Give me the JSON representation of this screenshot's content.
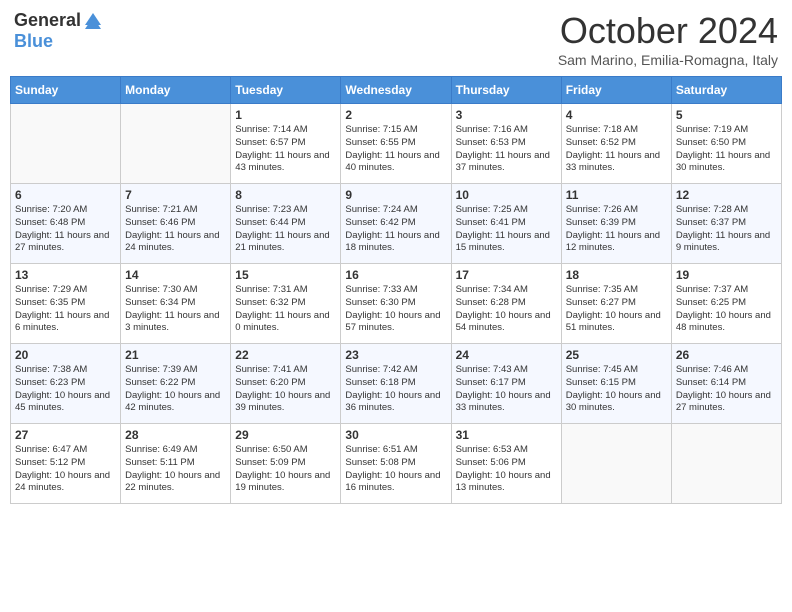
{
  "header": {
    "logo_general": "General",
    "logo_blue": "Blue",
    "month_title": "October 2024",
    "subtitle": "Sam Marino, Emilia-Romagna, Italy"
  },
  "days_of_week": [
    "Sunday",
    "Monday",
    "Tuesday",
    "Wednesday",
    "Thursday",
    "Friday",
    "Saturday"
  ],
  "weeks": [
    [
      {
        "date": "",
        "sunrise": "",
        "sunset": "",
        "daylight": ""
      },
      {
        "date": "",
        "sunrise": "",
        "sunset": "",
        "daylight": ""
      },
      {
        "date": "1",
        "sunrise": "Sunrise: 7:14 AM",
        "sunset": "Sunset: 6:57 PM",
        "daylight": "Daylight: 11 hours and 43 minutes."
      },
      {
        "date": "2",
        "sunrise": "Sunrise: 7:15 AM",
        "sunset": "Sunset: 6:55 PM",
        "daylight": "Daylight: 11 hours and 40 minutes."
      },
      {
        "date": "3",
        "sunrise": "Sunrise: 7:16 AM",
        "sunset": "Sunset: 6:53 PM",
        "daylight": "Daylight: 11 hours and 37 minutes."
      },
      {
        "date": "4",
        "sunrise": "Sunrise: 7:18 AM",
        "sunset": "Sunset: 6:52 PM",
        "daylight": "Daylight: 11 hours and 33 minutes."
      },
      {
        "date": "5",
        "sunrise": "Sunrise: 7:19 AM",
        "sunset": "Sunset: 6:50 PM",
        "daylight": "Daylight: 11 hours and 30 minutes."
      }
    ],
    [
      {
        "date": "6",
        "sunrise": "Sunrise: 7:20 AM",
        "sunset": "Sunset: 6:48 PM",
        "daylight": "Daylight: 11 hours and 27 minutes."
      },
      {
        "date": "7",
        "sunrise": "Sunrise: 7:21 AM",
        "sunset": "Sunset: 6:46 PM",
        "daylight": "Daylight: 11 hours and 24 minutes."
      },
      {
        "date": "8",
        "sunrise": "Sunrise: 7:23 AM",
        "sunset": "Sunset: 6:44 PM",
        "daylight": "Daylight: 11 hours and 21 minutes."
      },
      {
        "date": "9",
        "sunrise": "Sunrise: 7:24 AM",
        "sunset": "Sunset: 6:42 PM",
        "daylight": "Daylight: 11 hours and 18 minutes."
      },
      {
        "date": "10",
        "sunrise": "Sunrise: 7:25 AM",
        "sunset": "Sunset: 6:41 PM",
        "daylight": "Daylight: 11 hours and 15 minutes."
      },
      {
        "date": "11",
        "sunrise": "Sunrise: 7:26 AM",
        "sunset": "Sunset: 6:39 PM",
        "daylight": "Daylight: 11 hours and 12 minutes."
      },
      {
        "date": "12",
        "sunrise": "Sunrise: 7:28 AM",
        "sunset": "Sunset: 6:37 PM",
        "daylight": "Daylight: 11 hours and 9 minutes."
      }
    ],
    [
      {
        "date": "13",
        "sunrise": "Sunrise: 7:29 AM",
        "sunset": "Sunset: 6:35 PM",
        "daylight": "Daylight: 11 hours and 6 minutes."
      },
      {
        "date": "14",
        "sunrise": "Sunrise: 7:30 AM",
        "sunset": "Sunset: 6:34 PM",
        "daylight": "Daylight: 11 hours and 3 minutes."
      },
      {
        "date": "15",
        "sunrise": "Sunrise: 7:31 AM",
        "sunset": "Sunset: 6:32 PM",
        "daylight": "Daylight: 11 hours and 0 minutes."
      },
      {
        "date": "16",
        "sunrise": "Sunrise: 7:33 AM",
        "sunset": "Sunset: 6:30 PM",
        "daylight": "Daylight: 10 hours and 57 minutes."
      },
      {
        "date": "17",
        "sunrise": "Sunrise: 7:34 AM",
        "sunset": "Sunset: 6:28 PM",
        "daylight": "Daylight: 10 hours and 54 minutes."
      },
      {
        "date": "18",
        "sunrise": "Sunrise: 7:35 AM",
        "sunset": "Sunset: 6:27 PM",
        "daylight": "Daylight: 10 hours and 51 minutes."
      },
      {
        "date": "19",
        "sunrise": "Sunrise: 7:37 AM",
        "sunset": "Sunset: 6:25 PM",
        "daylight": "Daylight: 10 hours and 48 minutes."
      }
    ],
    [
      {
        "date": "20",
        "sunrise": "Sunrise: 7:38 AM",
        "sunset": "Sunset: 6:23 PM",
        "daylight": "Daylight: 10 hours and 45 minutes."
      },
      {
        "date": "21",
        "sunrise": "Sunrise: 7:39 AM",
        "sunset": "Sunset: 6:22 PM",
        "daylight": "Daylight: 10 hours and 42 minutes."
      },
      {
        "date": "22",
        "sunrise": "Sunrise: 7:41 AM",
        "sunset": "Sunset: 6:20 PM",
        "daylight": "Daylight: 10 hours and 39 minutes."
      },
      {
        "date": "23",
        "sunrise": "Sunrise: 7:42 AM",
        "sunset": "Sunset: 6:18 PM",
        "daylight": "Daylight: 10 hours and 36 minutes."
      },
      {
        "date": "24",
        "sunrise": "Sunrise: 7:43 AM",
        "sunset": "Sunset: 6:17 PM",
        "daylight": "Daylight: 10 hours and 33 minutes."
      },
      {
        "date": "25",
        "sunrise": "Sunrise: 7:45 AM",
        "sunset": "Sunset: 6:15 PM",
        "daylight": "Daylight: 10 hours and 30 minutes."
      },
      {
        "date": "26",
        "sunrise": "Sunrise: 7:46 AM",
        "sunset": "Sunset: 6:14 PM",
        "daylight": "Daylight: 10 hours and 27 minutes."
      }
    ],
    [
      {
        "date": "27",
        "sunrise": "Sunrise: 6:47 AM",
        "sunset": "Sunset: 5:12 PM",
        "daylight": "Daylight: 10 hours and 24 minutes."
      },
      {
        "date": "28",
        "sunrise": "Sunrise: 6:49 AM",
        "sunset": "Sunset: 5:11 PM",
        "daylight": "Daylight: 10 hours and 22 minutes."
      },
      {
        "date": "29",
        "sunrise": "Sunrise: 6:50 AM",
        "sunset": "Sunset: 5:09 PM",
        "daylight": "Daylight: 10 hours and 19 minutes."
      },
      {
        "date": "30",
        "sunrise": "Sunrise: 6:51 AM",
        "sunset": "Sunset: 5:08 PM",
        "daylight": "Daylight: 10 hours and 16 minutes."
      },
      {
        "date": "31",
        "sunrise": "Sunrise: 6:53 AM",
        "sunset": "Sunset: 5:06 PM",
        "daylight": "Daylight: 10 hours and 13 minutes."
      },
      {
        "date": "",
        "sunrise": "",
        "sunset": "",
        "daylight": ""
      },
      {
        "date": "",
        "sunrise": "",
        "sunset": "",
        "daylight": ""
      }
    ]
  ]
}
